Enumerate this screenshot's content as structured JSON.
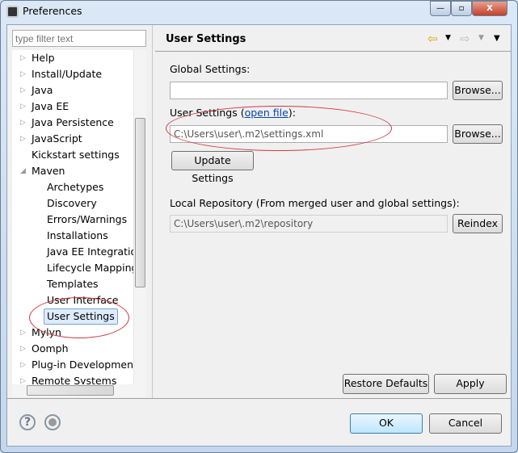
{
  "window": {
    "title": "Preferences",
    "minimize": "—",
    "maximize": "▫",
    "close": "X"
  },
  "filter": {
    "placeholder": "type filter text"
  },
  "tree": [
    {
      "label": "Help",
      "expandable": true,
      "level": 0
    },
    {
      "label": "Install/Update",
      "expandable": true,
      "level": 0
    },
    {
      "label": "Java",
      "expandable": true,
      "level": 0
    },
    {
      "label": "Java EE",
      "expandable": true,
      "level": 0
    },
    {
      "label": "Java Persistence",
      "expandable": true,
      "level": 0
    },
    {
      "label": "JavaScript",
      "expandable": true,
      "level": 0
    },
    {
      "label": "Kickstart settings",
      "expandable": false,
      "level": 0
    },
    {
      "label": "Maven",
      "expandable": true,
      "expanded": true,
      "level": 0
    },
    {
      "label": "Archetypes",
      "level": 1
    },
    {
      "label": "Discovery",
      "level": 1
    },
    {
      "label": "Errors/Warnings",
      "level": 1
    },
    {
      "label": "Installations",
      "level": 1
    },
    {
      "label": "Java EE Integration",
      "level": 1
    },
    {
      "label": "Lifecycle Mappings",
      "level": 1
    },
    {
      "label": "Templates",
      "level": 1
    },
    {
      "label": "User Interface",
      "level": 1
    },
    {
      "label": "User Settings",
      "level": 1,
      "selected": true
    },
    {
      "label": "Mylyn",
      "expandable": true,
      "level": 0
    },
    {
      "label": "Oomph",
      "expandable": true,
      "level": 0
    },
    {
      "label": "Plug-in Development",
      "expandable": true,
      "level": 0
    },
    {
      "label": "Remote Systems",
      "expandable": true,
      "level": 0
    }
  ],
  "page": {
    "title": "User Settings",
    "global_label": "Global Settings:",
    "global_value": "",
    "user_label_prefix": "User Settings (",
    "user_link": "open file",
    "user_label_suffix": "):",
    "user_value": "C:\\Users\\user\\.m2\\settings.xml",
    "browse": "Browse...",
    "update": "Update Settings",
    "local_label": "Local Repository (From merged user and global settings):",
    "local_value": "C:\\Users\\user\\.m2\\repository",
    "reindex": "Reindex",
    "restore": "Restore Defaults",
    "apply": "Apply"
  },
  "footer": {
    "ok": "OK",
    "cancel": "Cancel",
    "help": "?"
  },
  "annotation_color": "#d0383f"
}
